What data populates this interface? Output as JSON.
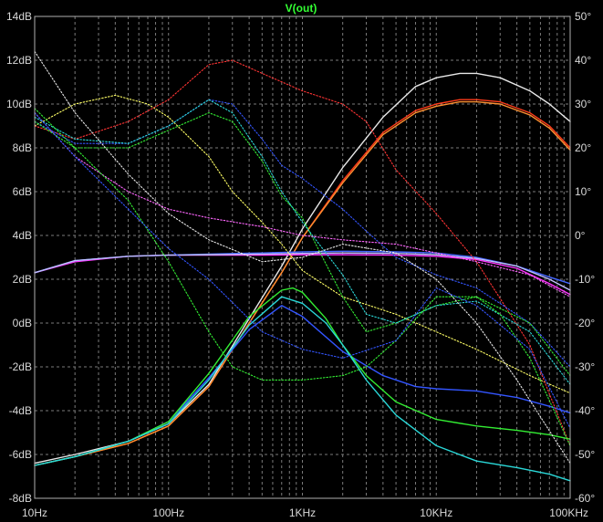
{
  "chart_data": {
    "type": "line",
    "title": "V(out)",
    "x_scale": "log",
    "xlim": [
      10,
      100000
    ],
    "x_ticks": [
      {
        "value": 10,
        "label": "10Hz"
      },
      {
        "value": 100,
        "label": "100Hz"
      },
      {
        "value": 1000,
        "label": "1KHz"
      },
      {
        "value": 10000,
        "label": "10KHz"
      },
      {
        "value": 100000,
        "label": "100KHz"
      }
    ],
    "ylim_left": [
      -8,
      14
    ],
    "y_left_ticks": [
      {
        "value": 14,
        "label": "14dB"
      },
      {
        "value": 12,
        "label": "12dB"
      },
      {
        "value": 10,
        "label": "10dB"
      },
      {
        "value": 8,
        "label": "8dB"
      },
      {
        "value": 6,
        "label": "6dB"
      },
      {
        "value": 4,
        "label": "4dB"
      },
      {
        "value": 2,
        "label": "2dB"
      },
      {
        "value": 0,
        "label": "0dB"
      },
      {
        "value": -2,
        "label": "-2dB"
      },
      {
        "value": -4,
        "label": "-4dB"
      },
      {
        "value": -6,
        "label": "-6dB"
      },
      {
        "value": -8,
        "label": "-8dB"
      }
    ],
    "ylim_right": [
      -60,
      50
    ],
    "y_right_ticks": [
      {
        "value": 50,
        "label": "50°"
      },
      {
        "value": 40,
        "label": "40°"
      },
      {
        "value": 30,
        "label": "30°"
      },
      {
        "value": 20,
        "label": "20°"
      },
      {
        "value": 10,
        "label": "10°"
      },
      {
        "value": 0,
        "label": "0°"
      },
      {
        "value": -10,
        "label": "-10°"
      },
      {
        "value": -20,
        "label": "-20°"
      },
      {
        "value": -30,
        "label": "-30°"
      },
      {
        "value": -40,
        "label": "-40°"
      },
      {
        "value": -50,
        "label": "-50°"
      },
      {
        "value": -60,
        "label": "-60°"
      }
    ],
    "grid": true,
    "colors": {
      "background": "#000000",
      "frame": "#b0b0b0",
      "grid": "#7a7a7a",
      "text": "#d8d8d8",
      "title": "#33ff33"
    },
    "series": [
      {
        "color": "#e8e8e8",
        "axis": "left",
        "dash": "solid",
        "x": [
          10,
          20,
          50,
          100,
          200,
          400,
          700,
          1000,
          2000,
          4000,
          7000,
          10000,
          15000,
          20000,
          30000,
          50000,
          70000,
          100000
        ],
        "y": [
          -6.4,
          -6.0,
          -5.4,
          -4.6,
          -2.8,
          0.2,
          2.6,
          4.3,
          7.1,
          9.4,
          10.8,
          11.2,
          11.4,
          11.4,
          11.2,
          10.6,
          10.0,
          9.2
        ]
      },
      {
        "color": "#ff3b1a",
        "axis": "left",
        "dash": "solid",
        "x": [
          10,
          20,
          50,
          100,
          200,
          400,
          700,
          1000,
          2000,
          4000,
          7000,
          10000,
          15000,
          20000,
          30000,
          50000,
          70000,
          100000
        ],
        "y": [
          -6.5,
          -6.1,
          -5.5,
          -4.7,
          -2.9,
          0.0,
          2.3,
          3.9,
          6.5,
          8.7,
          9.7,
          10.0,
          10.2,
          10.2,
          10.1,
          9.6,
          9.0,
          8.0
        ]
      },
      {
        "color": "#ff9030",
        "axis": "left",
        "dash": "solid",
        "x": [
          10,
          20,
          50,
          100,
          200,
          400,
          700,
          1000,
          2000,
          4000,
          7000,
          10000,
          15000,
          20000,
          30000,
          50000,
          70000,
          100000
        ],
        "y": [
          -6.5,
          -6.1,
          -5.5,
          -4.7,
          -2.9,
          0.0,
          2.3,
          3.9,
          6.4,
          8.6,
          9.6,
          9.9,
          10.1,
          10.1,
          10.0,
          9.5,
          8.9,
          7.9
        ]
      },
      {
        "color": "#3355ff",
        "axis": "left",
        "dash": "solid",
        "x": [
          10,
          20,
          50,
          100,
          200,
          400,
          700,
          1000,
          2000,
          4000,
          7000,
          10000,
          20000,
          40000,
          70000,
          100000
        ],
        "y": [
          -6.5,
          -6.1,
          -5.4,
          -4.5,
          -2.5,
          -0.3,
          0.8,
          0.3,
          -1.3,
          -2.4,
          -2.9,
          -3.0,
          -3.1,
          -3.4,
          -3.8,
          -4.1
        ]
      },
      {
        "color": "#33ee33",
        "axis": "left",
        "dash": "solid",
        "x": [
          10,
          20,
          50,
          100,
          200,
          400,
          700,
          850,
          1000,
          1500,
          2000,
          3000,
          5000,
          10000,
          20000,
          40000,
          70000,
          100000
        ],
        "y": [
          -6.5,
          -6.1,
          -5.4,
          -4.5,
          -2.3,
          0.3,
          1.5,
          1.6,
          1.4,
          0.2,
          -1.0,
          -2.4,
          -3.6,
          -4.4,
          -4.7,
          -4.9,
          -5.1,
          -5.3
        ]
      },
      {
        "color": "#2ad8d8",
        "axis": "left",
        "dash": "solid",
        "x": [
          10,
          20,
          50,
          100,
          200,
          400,
          700,
          1000,
          1500,
          2000,
          3000,
          5000,
          10000,
          20000,
          40000,
          70000,
          100000
        ],
        "y": [
          -6.5,
          -6.1,
          -5.4,
          -4.6,
          -2.6,
          -0.1,
          1.2,
          0.9,
          0.0,
          -1.0,
          -2.6,
          -4.2,
          -5.6,
          -6.3,
          -6.6,
          -6.9,
          -7.2
        ]
      },
      {
        "color": "#ff33ff",
        "axis": "left",
        "dash": "solid",
        "x": [
          10,
          20,
          50,
          100,
          200,
          500,
          1000,
          2000,
          5000,
          10000,
          20000,
          40000,
          70000,
          100000
        ],
        "y": [
          2.3,
          2.8,
          3.05,
          3.1,
          3.1,
          3.1,
          3.12,
          3.12,
          3.1,
          3.05,
          2.9,
          2.5,
          1.8,
          1.3
        ]
      },
      {
        "color": "#4466ff",
        "axis": "left",
        "dash": "solid",
        "x": [
          10,
          20,
          50,
          100,
          200,
          500,
          1000,
          2000,
          5000,
          10000,
          20000,
          40000,
          70000,
          100000
        ],
        "y": [
          2.3,
          2.85,
          3.05,
          3.1,
          3.15,
          3.2,
          3.25,
          3.28,
          3.25,
          3.2,
          3.0,
          2.6,
          2.1,
          1.8
        ]
      },
      {
        "color": "#c0c0ff",
        "axis": "left",
        "dash": "solid",
        "x": [
          10,
          20,
          50,
          100,
          200,
          500,
          1000,
          2000,
          5000,
          10000,
          20000,
          40000,
          70000,
          100000
        ],
        "y": [
          2.3,
          2.85,
          3.05,
          3.1,
          3.12,
          3.15,
          3.18,
          3.2,
          3.18,
          3.12,
          2.95,
          2.6,
          2.0,
          1.5
        ]
      },
      {
        "color": "#ffff66",
        "axis": "right",
        "dash": "dotted",
        "x": [
          10,
          20,
          40,
          70,
          100,
          200,
          300,
          500,
          700,
          1000,
          2000,
          5000,
          10000,
          20000,
          50000,
          100000
        ],
        "y": [
          25,
          30,
          32,
          30,
          27,
          18,
          10,
          3,
          -2,
          -8,
          -14,
          -18,
          -22,
          -26,
          -32,
          -36
        ]
      },
      {
        "color": "#ff3333",
        "axis": "right",
        "dash": "dotted",
        "x": [
          10,
          20,
          50,
          100,
          200,
          300,
          500,
          1000,
          2000,
          3000,
          5000,
          10000,
          20000,
          50000,
          100000
        ],
        "y": [
          25,
          22,
          26,
          31,
          39,
          40,
          37,
          33,
          30,
          26,
          15,
          5,
          -6,
          -25,
          -48
        ]
      },
      {
        "color": "#3355ff",
        "axis": "right",
        "dash": "dotted",
        "x": [
          10,
          20,
          50,
          100,
          200,
          300,
          500,
          700,
          1000,
          2000,
          3000,
          5000,
          10000,
          20000,
          50000,
          100000
        ],
        "y": [
          26,
          21,
          21,
          25,
          31,
          30,
          22,
          16,
          13,
          6,
          1,
          -5,
          -9,
          -12,
          -20,
          -30
        ]
      },
      {
        "color": "#33ee33",
        "axis": "right",
        "dash": "dotted",
        "x": [
          10,
          20,
          50,
          100,
          200,
          300,
          500,
          700,
          1000,
          2000,
          3000,
          5000,
          10000,
          20000,
          50000,
          100000
        ],
        "y": [
          26,
          20,
          20,
          24,
          28,
          26,
          17,
          9,
          4,
          -14,
          -22,
          -20,
          -16,
          -14,
          -20,
          -32
        ]
      },
      {
        "color": "#2ad8d8",
        "axis": "right",
        "dash": "dotted",
        "x": [
          10,
          20,
          50,
          100,
          200,
          300,
          500,
          700,
          1000,
          2000,
          3000,
          5000,
          10000,
          20000,
          50000,
          100000
        ],
        "y": [
          27,
          22,
          21,
          25,
          31,
          28,
          18,
          10,
          3,
          -9,
          -18,
          -20,
          -16,
          -15,
          -22,
          -34
        ]
      },
      {
        "color": "#e8e8e8",
        "axis": "right",
        "dash": "dotted",
        "x": [
          10,
          20,
          50,
          100,
          200,
          500,
          1000,
          2000,
          5000,
          10000,
          20000,
          40000,
          100000
        ],
        "y": [
          42,
          28,
          14,
          5,
          -1,
          -6,
          -5,
          -2,
          -4,
          -10,
          -20,
          -33,
          -52
        ]
      },
      {
        "color": "#ff66ff",
        "axis": "right",
        "dash": "dotted",
        "x": [
          10,
          20,
          50,
          100,
          200,
          500,
          1000,
          2000,
          5000,
          10000,
          20000,
          50000,
          100000
        ],
        "y": [
          28,
          18,
          10,
          6,
          4,
          2,
          0,
          -1,
          -2,
          -4,
          -6,
          -9,
          -14
        ]
      },
      {
        "color": "#33ee33",
        "axis": "right",
        "dash": "dotted",
        "x": [
          10,
          20,
          50,
          100,
          200,
          300,
          500,
          1000,
          2000,
          3000,
          5000,
          10000,
          20000,
          30000,
          50000,
          100000
        ],
        "y": [
          29,
          20,
          8,
          -6,
          -22,
          -30,
          -33,
          -33,
          -32,
          -30,
          -24,
          -14,
          -14,
          -18,
          -28,
          -48
        ]
      },
      {
        "color": "#3355ff",
        "axis": "right",
        "dash": "dotted",
        "x": [
          10,
          20,
          50,
          100,
          200,
          500,
          1000,
          2000,
          5000,
          10000,
          20000,
          50000,
          100000
        ],
        "y": [
          28,
          18,
          6,
          -3,
          -10,
          -22,
          -26,
          -28,
          -24,
          -12,
          -16,
          -26,
          -44
        ]
      }
    ]
  }
}
